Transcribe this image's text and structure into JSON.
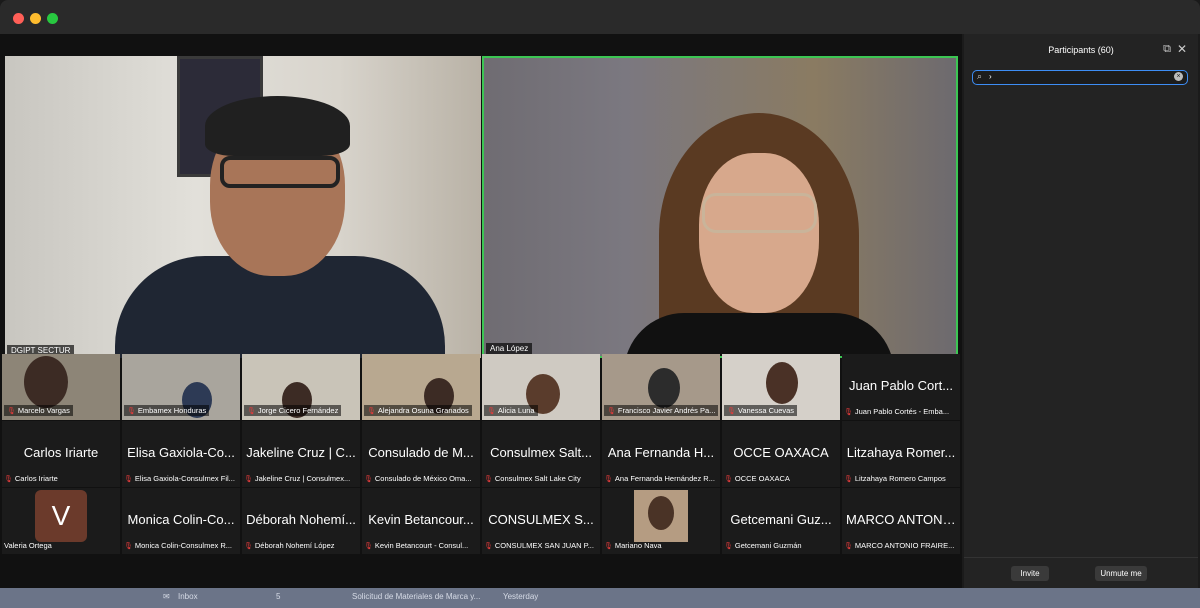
{
  "sidebar": {
    "title": "Participants (60)",
    "search_value": "›",
    "invite_label": "Invite",
    "unmute_label": "Unmute me"
  },
  "main_videos": [
    {
      "name": "DGIPT SECTUR"
    },
    {
      "name": "Ana López"
    }
  ],
  "gallery": {
    "row1": [
      {
        "label": "Marcelo Vargas"
      },
      {
        "label": "Embamex Honduras"
      },
      {
        "label": "Jorge Cicero Fernández"
      },
      {
        "label": "Alejandra Osuna Granados"
      },
      {
        "label": "Alicia Luna"
      },
      {
        "label": "Francisco Javier Andrés Pa..."
      },
      {
        "label": "Vanessa Cuevas"
      },
      {
        "big": "Juan Pablo Cort...",
        "label": "Juan Pablo Cortés - Emba..."
      }
    ],
    "row2": [
      {
        "big": "Carlos Iriarte",
        "label": "Carlos Iriarte"
      },
      {
        "big": "Elisa Gaxiola-Co...",
        "label": "Elisa Gaxiola-Consulmex Fil..."
      },
      {
        "big": "Jakeline Cruz | C...",
        "label": "Jakeline Cruz | Consulmex..."
      },
      {
        "big": "Consulado de M...",
        "label": "Consulado de México Oma..."
      },
      {
        "big": "Consulmex Salt...",
        "label": "Consulmex Salt Lake City"
      },
      {
        "big": "Ana Fernanda H...",
        "label": "Ana Fernanda Hernández R..."
      },
      {
        "big": "OCCE OAXACA",
        "label": "OCCE OAXACA"
      },
      {
        "big": "Litzahaya Romer...",
        "label": "Litzahaya Romero Campos"
      }
    ],
    "row3": [
      {
        "avatar": "V",
        "label": "Valeria Ortega"
      },
      {
        "big": "Monica Colin-Co...",
        "label": "Monica Colin-Consulmex R..."
      },
      {
        "big": "Déborah Nohemí...",
        "label": "Déborah Nohemí López"
      },
      {
        "big": "Kevin Betancour...",
        "label": "Kevin Betancourt - Consul..."
      },
      {
        "big": "CONSULMEX S...",
        "label": "CONSULMEX SAN JUAN P..."
      },
      {
        "label": "Mariano Nava"
      },
      {
        "big": "Getcemani Guz...",
        "label": "Getcemani Guzmán"
      },
      {
        "big": "MARCO ANTONI...",
        "label": "MARCO ANTONIO FRAIRE..."
      }
    ]
  },
  "taskbar": {
    "inbox": "Inbox",
    "count": "5",
    "subject": "Solicitud de Materiales de Marca y...",
    "time": "Yesterday"
  }
}
